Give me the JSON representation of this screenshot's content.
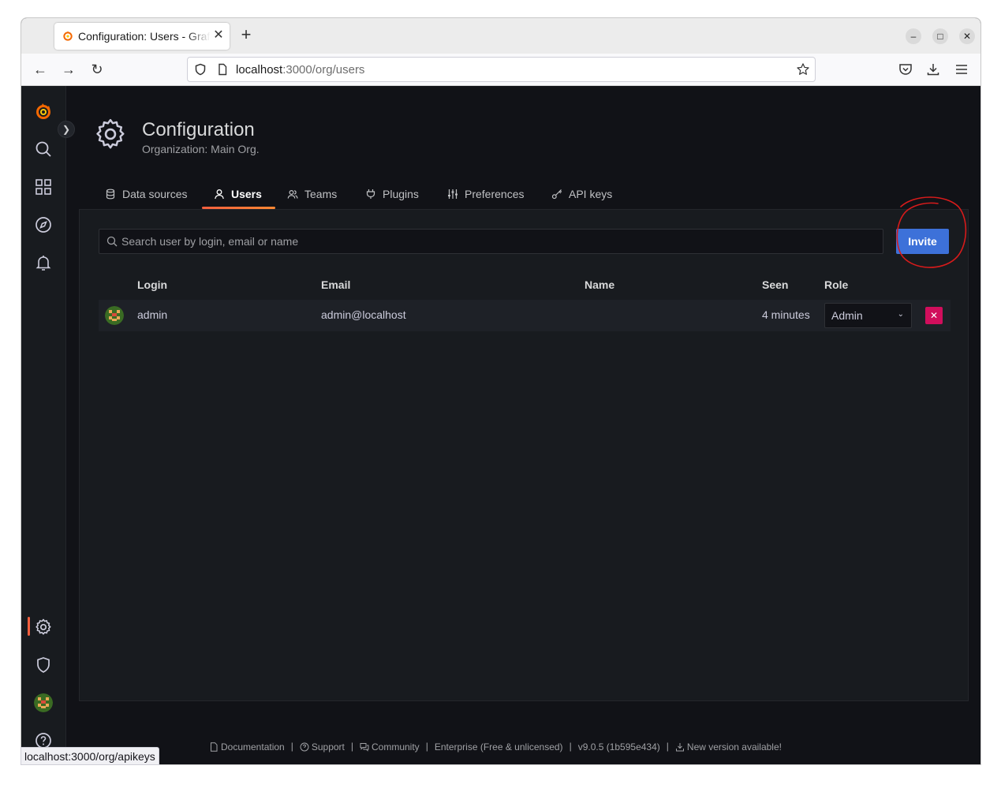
{
  "browser": {
    "tab_title": "Configuration: Users - Grafana",
    "url_host": "localhost",
    "url_path": ":3000/org/users",
    "status_url": "localhost:3000/org/apikeys"
  },
  "page": {
    "title": "Configuration",
    "subtitle": "Organization: Main Org."
  },
  "tabs": [
    {
      "label": "Data sources",
      "icon": "database-icon"
    },
    {
      "label": "Users",
      "icon": "user-icon",
      "active": true
    },
    {
      "label": "Teams",
      "icon": "users-icon"
    },
    {
      "label": "Plugins",
      "icon": "plug-icon"
    },
    {
      "label": "Preferences",
      "icon": "sliders-icon"
    },
    {
      "label": "API keys",
      "icon": "key-icon"
    }
  ],
  "users": {
    "search_placeholder": "Search user by login, email or name",
    "invite_label": "Invite",
    "columns": [
      "Login",
      "Email",
      "Name",
      "Seen",
      "Role"
    ],
    "rows": [
      {
        "login": "admin",
        "email": "admin@localhost",
        "name": "",
        "seen": "4 minutes",
        "role": "Admin"
      }
    ]
  },
  "footer": {
    "documentation": "Documentation",
    "support": "Support",
    "community": "Community",
    "edition": "Enterprise (Free & unlicensed)",
    "version": "v9.0.5 (1b595e434)",
    "new_version": "New version available!"
  },
  "colors": {
    "accent": "#f55f3e",
    "primary_button": "#3d71d9",
    "destructive": "#d10e5c",
    "annotation": "#d81b1b"
  }
}
